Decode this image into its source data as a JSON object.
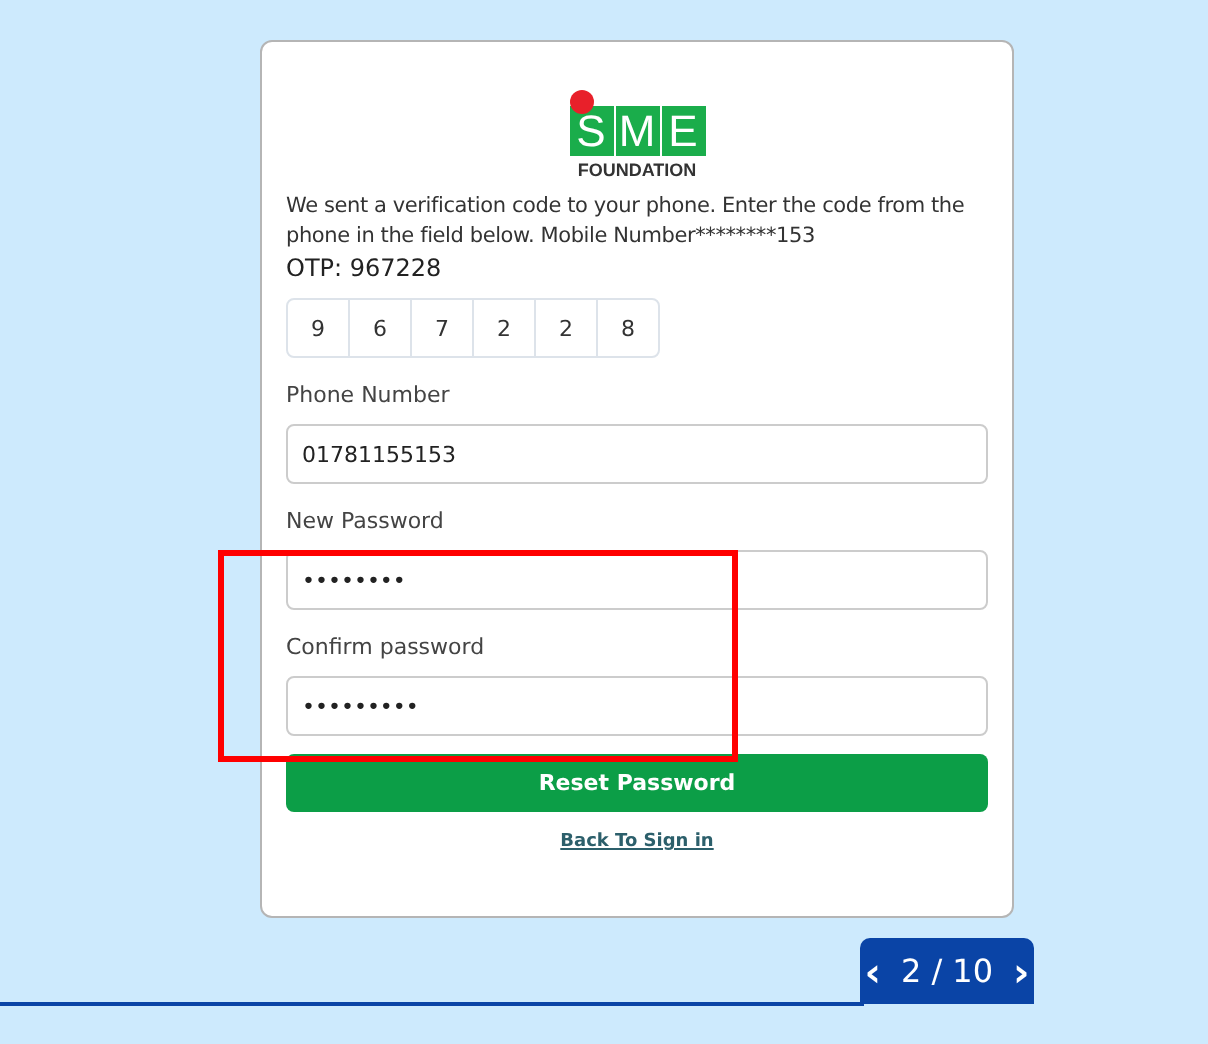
{
  "logo": {
    "letters": [
      "S",
      "M",
      "E"
    ],
    "subtitle": "FOUNDATION"
  },
  "message": "We sent a verification code to your phone. Enter the code from the phone in the field below. Mobile Number********153",
  "otp_text": "OTP: 967228",
  "otp_digits": [
    "9",
    "6",
    "7",
    "2",
    "2",
    "8"
  ],
  "fields": [
    {
      "label": "Phone Number",
      "value": "01781155153"
    },
    {
      "label": "New Password",
      "value": "••••••••"
    },
    {
      "label": "Confirm password",
      "value": "•••••••••"
    }
  ],
  "highlight_box": true,
  "submit_button": "Reset Password",
  "back_link": "Back To Sign in",
  "pager": {
    "prev": "‹",
    "text": "2 / 10",
    "next": "›"
  }
}
